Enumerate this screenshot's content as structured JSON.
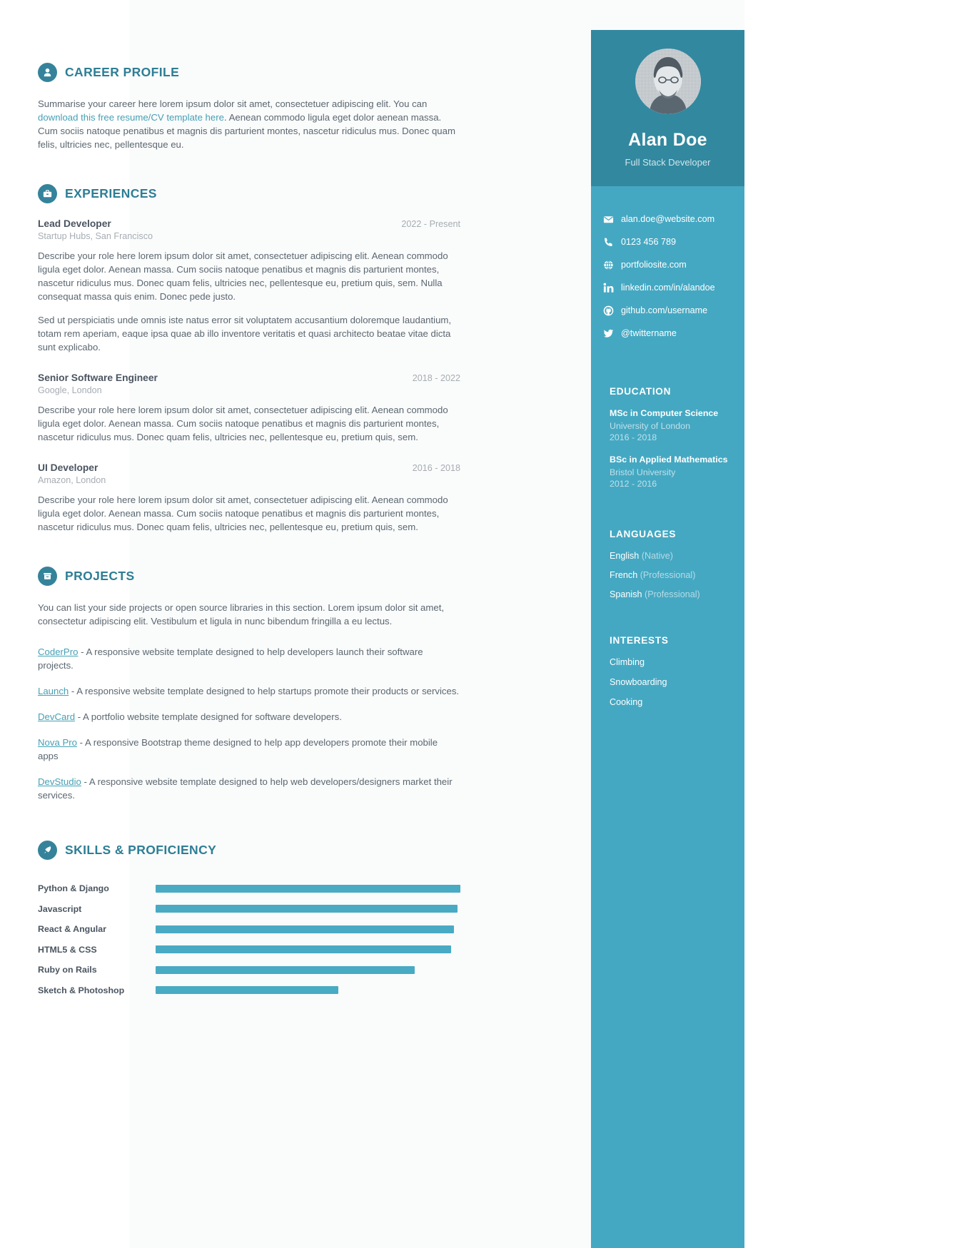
{
  "theme": {
    "sidebar_header_bg": "#32889f",
    "sidebar_body_bg": "#45a8c2",
    "accent": "#2d7e95",
    "link": "#46a0b5",
    "bar_fill": "#49aac4",
    "sheet_bg": "#fafbfb"
  },
  "main": {
    "career": {
      "title": "CAREER PROFILE",
      "icon": "user-icon",
      "paragraph_before_link": "Summarise your career here lorem ipsum dolor sit amet, consectetuer adipiscing elit. You can ",
      "link_text": "download this free resume/CV template here",
      "paragraph_after_link": ". Aenean commodo ligula eget dolor aenean massa. Cum sociis natoque penatibus et magnis dis parturient montes, nascetur ridiculus mus. Donec quam felis, ultricies nec, pellentesque eu."
    },
    "experiences": {
      "title": "EXPERIENCES",
      "icon": "briefcase-icon",
      "jobs": [
        {
          "title": "Lead Developer",
          "date": "2022 - Present",
          "company": "Startup Hubs, San Francisco",
          "paragraphs": [
            "Describe your role here lorem ipsum dolor sit amet, consectetuer adipiscing elit. Aenean commodo ligula eget dolor. Aenean massa. Cum sociis natoque penatibus et magnis dis parturient montes, nascetur ridiculus mus. Donec quam felis, ultricies nec, pellentesque eu, pretium quis, sem. Nulla consequat massa quis enim. Donec pede justo.",
            "Sed ut perspiciatis unde omnis iste natus error sit voluptatem accusantium doloremque laudantium, totam rem aperiam, eaque ipsa quae ab illo inventore veritatis et quasi architecto beatae vitae dicta sunt explicabo."
          ]
        },
        {
          "title": "Senior Software Engineer",
          "date": "2018 - 2022",
          "company": "Google, London",
          "paragraphs": [
            "Describe your role here lorem ipsum dolor sit amet, consectetuer adipiscing elit. Aenean commodo ligula eget dolor. Aenean massa. Cum sociis natoque penatibus et magnis dis parturient montes, nascetur ridiculus mus. Donec quam felis, ultricies nec, pellentesque eu, pretium quis, sem."
          ]
        },
        {
          "title": "UI Developer",
          "date": "2016 - 2018",
          "company": "Amazon, London",
          "paragraphs": [
            "Describe your role here lorem ipsum dolor sit amet, consectetuer adipiscing elit. Aenean commodo ligula eget dolor. Aenean massa. Cum sociis natoque penatibus et magnis dis parturient montes, nascetur ridiculus mus. Donec quam felis, ultricies nec, pellentesque eu, pretium quis, sem."
          ]
        }
      ]
    },
    "projects": {
      "title": "PROJECTS",
      "icon": "archive-icon",
      "intro": "You can list your side projects or open source libraries in this section. Lorem ipsum dolor sit amet, consectetur adipiscing elit. Vestibulum et ligula in nunc bibendum fringilla a eu lectus.",
      "items": [
        {
          "name": "CoderPro",
          "desc": " - A responsive website template designed to help developers launch their software projects."
        },
        {
          "name": "Launch",
          "desc": " - A responsive website template designed to help startups promote their products or services."
        },
        {
          "name": "DevCard",
          "desc": " - A portfolio website template designed for software developers."
        },
        {
          "name": "Nova Pro",
          "desc": " - A responsive Bootstrap theme designed to help app developers promote their mobile apps"
        },
        {
          "name": "DevStudio",
          "desc": " - A responsive website template designed to help web developers/designers market their services."
        }
      ]
    },
    "skills": {
      "title": "SKILLS & PROFICIENCY",
      "icon": "rocket-icon",
      "items": [
        {
          "label": "Python & Django",
          "percent": 100
        },
        {
          "label": "Javascript",
          "percent": 99
        },
        {
          "label": "React & Angular",
          "percent": 98
        },
        {
          "label": "HTML5 & CSS",
          "percent": 97
        },
        {
          "label": "Ruby on Rails",
          "percent": 85
        },
        {
          "label": "Sketch & Photoshop",
          "percent": 60
        }
      ]
    }
  },
  "sidebar": {
    "avatar_alt": "profile-photo",
    "name": "Alan Doe",
    "role": "Full Stack Developer",
    "contacts": [
      {
        "icon": "envelope-icon",
        "text": "alan.doe@website.com"
      },
      {
        "icon": "phone-icon",
        "text": "0123 456 789"
      },
      {
        "icon": "globe-icon",
        "text": "portfoliosite.com"
      },
      {
        "icon": "linkedin-icon",
        "text": "linkedin.com/in/alandoe"
      },
      {
        "icon": "github-icon",
        "text": "github.com/username"
      },
      {
        "icon": "twitter-icon",
        "text": "@twittername"
      }
    ],
    "education": {
      "title": "EDUCATION",
      "items": [
        {
          "degree": "MSc in Computer Science",
          "school": "University of London",
          "years": "2016 - 2018"
        },
        {
          "degree": "BSc in Applied Mathematics",
          "school": "Bristol University",
          "years": "2012 - 2016"
        }
      ]
    },
    "languages": {
      "title": "LANGUAGES",
      "items": [
        {
          "name": "English",
          "level": "(Native)"
        },
        {
          "name": "French",
          "level": "(Professional)"
        },
        {
          "name": "Spanish",
          "level": "(Professional)"
        }
      ]
    },
    "interests": {
      "title": "INTERESTS",
      "items": [
        {
          "label": "Climbing"
        },
        {
          "label": "Snowboarding"
        },
        {
          "label": "Cooking"
        }
      ]
    }
  }
}
